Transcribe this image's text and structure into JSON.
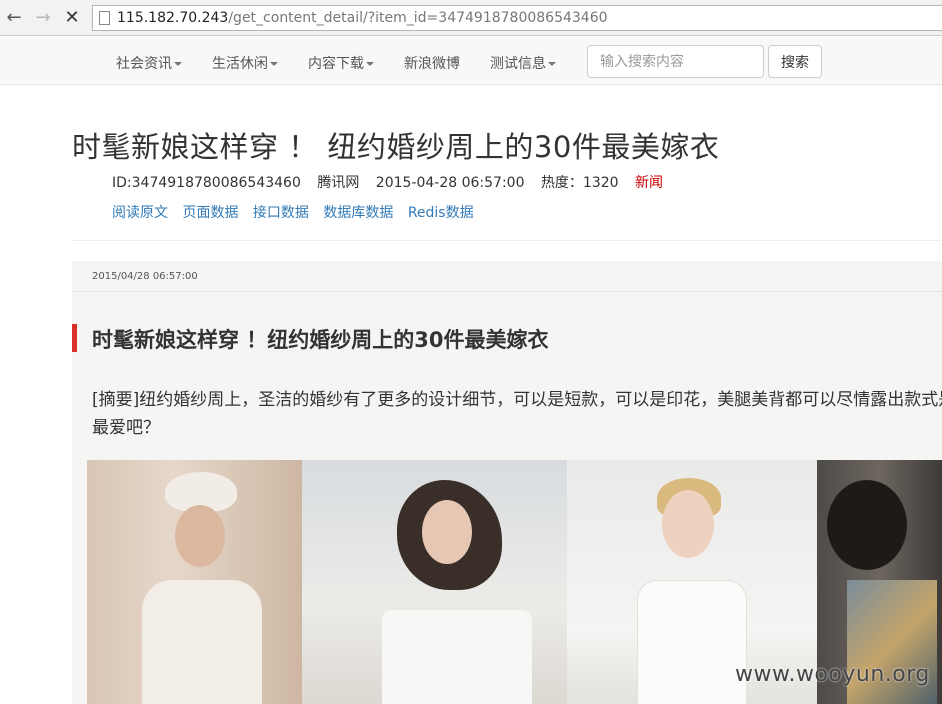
{
  "browser": {
    "url_host": "115.182.70.243",
    "url_path": "/get_content_detail/?item_id=3474918780086543460",
    "back_icon": "arrow-left",
    "forward_icon": "arrow-right",
    "stop_icon": "close-x"
  },
  "navbar": {
    "items": [
      {
        "label": "社会资讯",
        "dropdown": true
      },
      {
        "label": "生活休闲",
        "dropdown": true
      },
      {
        "label": "内容下载",
        "dropdown": true
      },
      {
        "label": "新浪微博",
        "dropdown": false
      },
      {
        "label": "测试信息",
        "dropdown": true
      }
    ],
    "search_placeholder": "输入搜索内容",
    "search_button": "搜索"
  },
  "article": {
    "title": "时髦新娘这样穿 ！ 纽约婚纱周上的30件最美嫁衣",
    "meta": {
      "id": "ID:3474918780086543460",
      "source": "腾讯网",
      "time": "2015-04-28 06:57:00",
      "heat": "热度：1320",
      "category": "新闻"
    },
    "links": [
      "阅读原文",
      "页面数据",
      "接口数据",
      "数据库数据",
      "Redis数据"
    ],
    "body": {
      "date": "2015/04/28 06:57:00",
      "heading": "时髦新娘这样穿 ！纽约婚纱周上的30件最美嫁衣",
      "summary": "[摘要]纽约婚纱周上，圣洁的婚纱有了更多的设计细节，可以是短款，可以是印花，美腿美背都可以尽情露出款式是你的最爱吧？"
    }
  },
  "watermark": "www.wooyun.org",
  "colors": {
    "accent_bar": "#d9302a",
    "category": "#cc0000",
    "link": "#337ab7"
  }
}
